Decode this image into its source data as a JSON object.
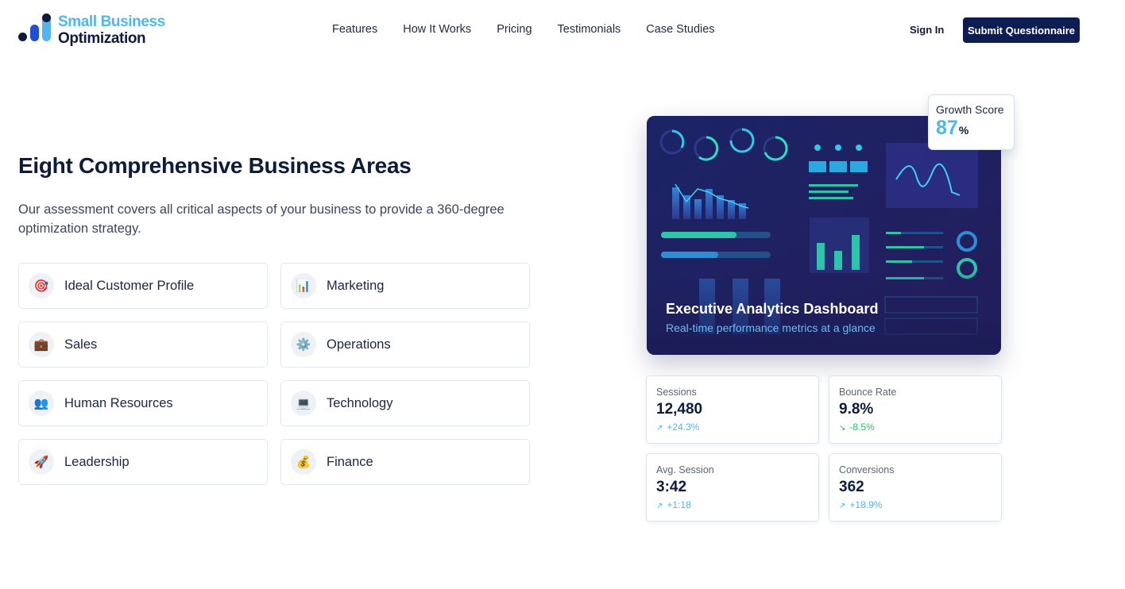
{
  "brand": {
    "line1": "Small Business",
    "line2": "Optimization"
  },
  "nav": {
    "links": [
      "Features",
      "How It Works",
      "Pricing",
      "Testimonials",
      "Case Studies"
    ],
    "sign_in": "Sign In",
    "cta": "Submit Questionnaire"
  },
  "hero": {
    "title": "Eight Comprehensive Business Areas",
    "lead": "Our assessment covers all critical aspects of your business to provide a 360-degree optimization strategy."
  },
  "areas": [
    {
      "label": "Ideal Customer Profile",
      "icon": "target-icon",
      "glyph": "🎯"
    },
    {
      "label": "Marketing",
      "icon": "bar-chart-icon",
      "glyph": "📊"
    },
    {
      "label": "Sales",
      "icon": "briefcase-icon",
      "glyph": "💼"
    },
    {
      "label": "Operations",
      "icon": "gear-icon",
      "glyph": "⚙️"
    },
    {
      "label": "Human Resources",
      "icon": "people-icon",
      "glyph": "👥"
    },
    {
      "label": "Technology",
      "icon": "computer-icon",
      "glyph": "💻"
    },
    {
      "label": "Leadership",
      "icon": "rocket-icon",
      "glyph": "🚀"
    },
    {
      "label": "Finance",
      "icon": "money-bag-icon",
      "glyph": "💰"
    }
  ],
  "dashboard": {
    "title": "Executive Analytics Dashboard",
    "subtitle": "Real-time performance metrics at a glance",
    "growth_label": "Growth Score",
    "growth_value": "87",
    "growth_unit": "%"
  },
  "metrics": [
    {
      "label": "Sessions",
      "value": "12,480",
      "change": "+24.3%",
      "direction": "up",
      "color": "#4fb6f0"
    },
    {
      "label": "Bounce Rate",
      "value": "9.8%",
      "change": "-8.5%",
      "direction": "down",
      "color": "#22c55e"
    },
    {
      "label": "Avg. Session",
      "value": "3:42",
      "change": "+1:18",
      "direction": "up",
      "color": "#4fb6f0"
    },
    {
      "label": "Conversions",
      "value": "362",
      "change": "+18.9%",
      "direction": "up",
      "color": "#4fb6f0"
    }
  ],
  "colors": {
    "primary": "#0d1d52",
    "accent": "#4fb6f0",
    "dashboard_bg": "#1e1f5e"
  }
}
